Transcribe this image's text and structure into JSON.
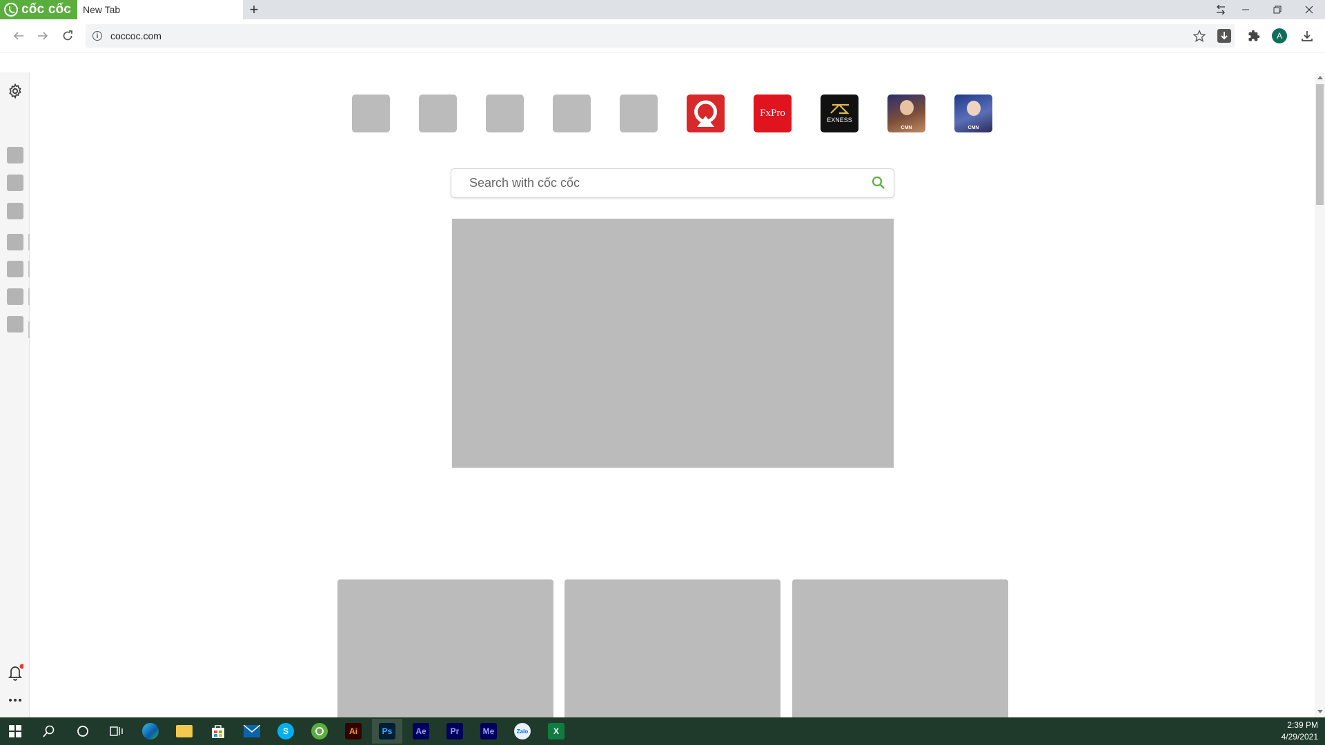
{
  "browser": {
    "brand": "cốc cốc",
    "active_tab_title": "New Tab",
    "address_url": "coccoc.com",
    "avatar_letter": "A"
  },
  "shortcuts": [
    {
      "name": "blank-1"
    },
    {
      "name": "blank-2"
    },
    {
      "name": "blank-3"
    },
    {
      "name": "blank-4"
    },
    {
      "name": "blank-5"
    },
    {
      "name": "red-app",
      "color": "#d8282a"
    },
    {
      "name": "FxPro",
      "label": "FxPro",
      "color": "#e0141e"
    },
    {
      "name": "EXNESS",
      "label": "EXNESS",
      "color": "#111111"
    },
    {
      "name": "game-1",
      "label": "CMN"
    },
    {
      "name": "game-2",
      "label": "CMN"
    }
  ],
  "search": {
    "placeholder": "Search with cốc cốc",
    "accent": "#5aae3e"
  },
  "taskbar": {
    "time": "2:39 PM",
    "date": "4/29/2021",
    "apps": [
      {
        "name": "edge",
        "label": "",
        "color": "#0c7bd1"
      },
      {
        "name": "file-explorer",
        "label": "",
        "color": "#f2c94c"
      },
      {
        "name": "store",
        "label": "",
        "color": "#0078d4"
      },
      {
        "name": "mail",
        "label": "",
        "color": "#0a64ad"
      },
      {
        "name": "skype",
        "label": "S",
        "color": "#00aff0"
      },
      {
        "name": "coccoc",
        "label": "",
        "color": "#5aae3e"
      },
      {
        "name": "illustrator",
        "label": "Ai",
        "color": "#330000"
      },
      {
        "name": "photoshop",
        "label": "Ps",
        "color": "#001e36"
      },
      {
        "name": "after-effects",
        "label": "Ae",
        "color": "#00005b"
      },
      {
        "name": "premiere",
        "label": "Pr",
        "color": "#00005b"
      },
      {
        "name": "media-encoder",
        "label": "Me",
        "color": "#00005b"
      },
      {
        "name": "zalo",
        "label": "Zalo",
        "color": "#e8f1ff"
      },
      {
        "name": "excel",
        "label": "X",
        "color": "#107c41"
      }
    ]
  }
}
